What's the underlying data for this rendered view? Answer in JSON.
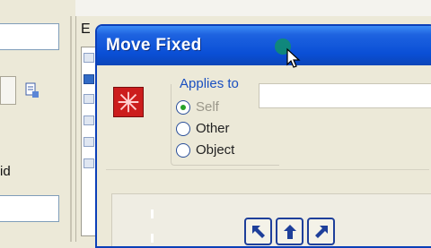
{
  "background_window": {
    "panel_title": "E",
    "label_fragment": "id"
  },
  "dialog": {
    "title": "Move Fixed",
    "applies_to": {
      "label": "Applies to",
      "options": [
        {
          "label": "Self",
          "checked": true,
          "enabled": false
        },
        {
          "label": "Other",
          "checked": false,
          "enabled": true
        },
        {
          "label": "Object",
          "checked": false,
          "enabled": true
        }
      ]
    },
    "direction_buttons": [
      {
        "name": "up-left-arrow-icon"
      },
      {
        "name": "up-arrow-icon"
      },
      {
        "name": "up-right-arrow-icon"
      }
    ]
  },
  "colors": {
    "title_bar": "#0a4fd6",
    "group_label": "#1a4fc0",
    "sprite": "#cc1d1d",
    "radio_check": "#27a327",
    "arrow": "#1e3f9a"
  }
}
